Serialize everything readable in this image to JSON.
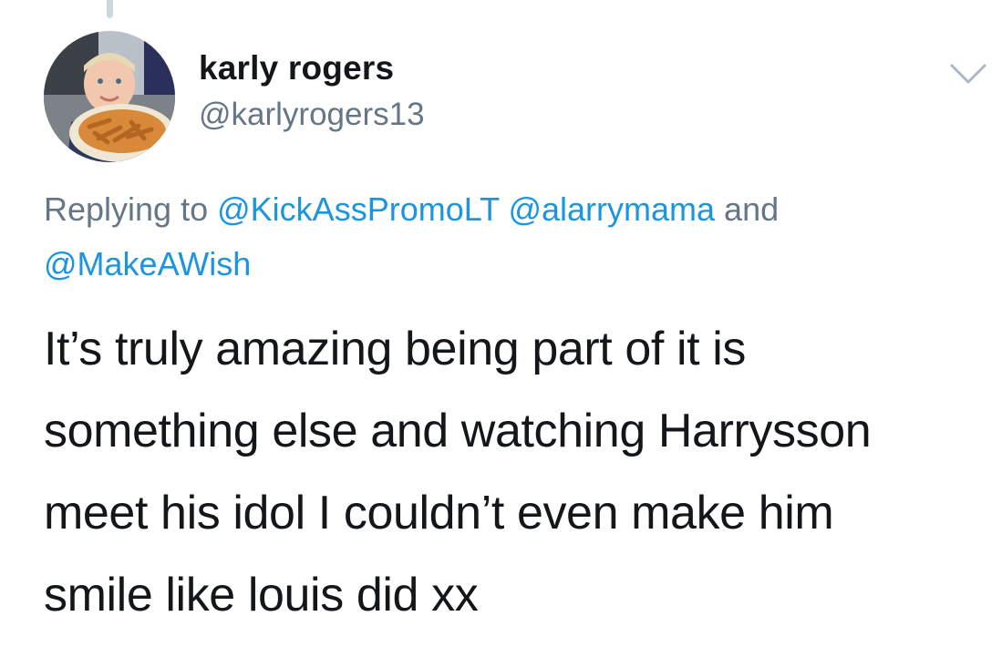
{
  "user": {
    "name": "karly rogers",
    "handle": "@karlyrogers13"
  },
  "reply": {
    "prefix": "Replying to",
    "mentions": [
      "@KickAssPromoLT",
      "@alarrymama",
      "@MakeAWish"
    ],
    "conjunction": "and"
  },
  "tweet": {
    "lines": [
      "It’s truly amazing being part of it is",
      "something else and watching Harrysson",
      "meet his idol I couldn’t even make him",
      "smile like louis did xx"
    ]
  },
  "icons": {
    "menu": "chevron-down-icon",
    "avatar": "avatar"
  },
  "colors": {
    "link": "#1b95e0",
    "secondary": "#657786",
    "text": "#14171a",
    "thread_line": "#ccd6dd"
  }
}
